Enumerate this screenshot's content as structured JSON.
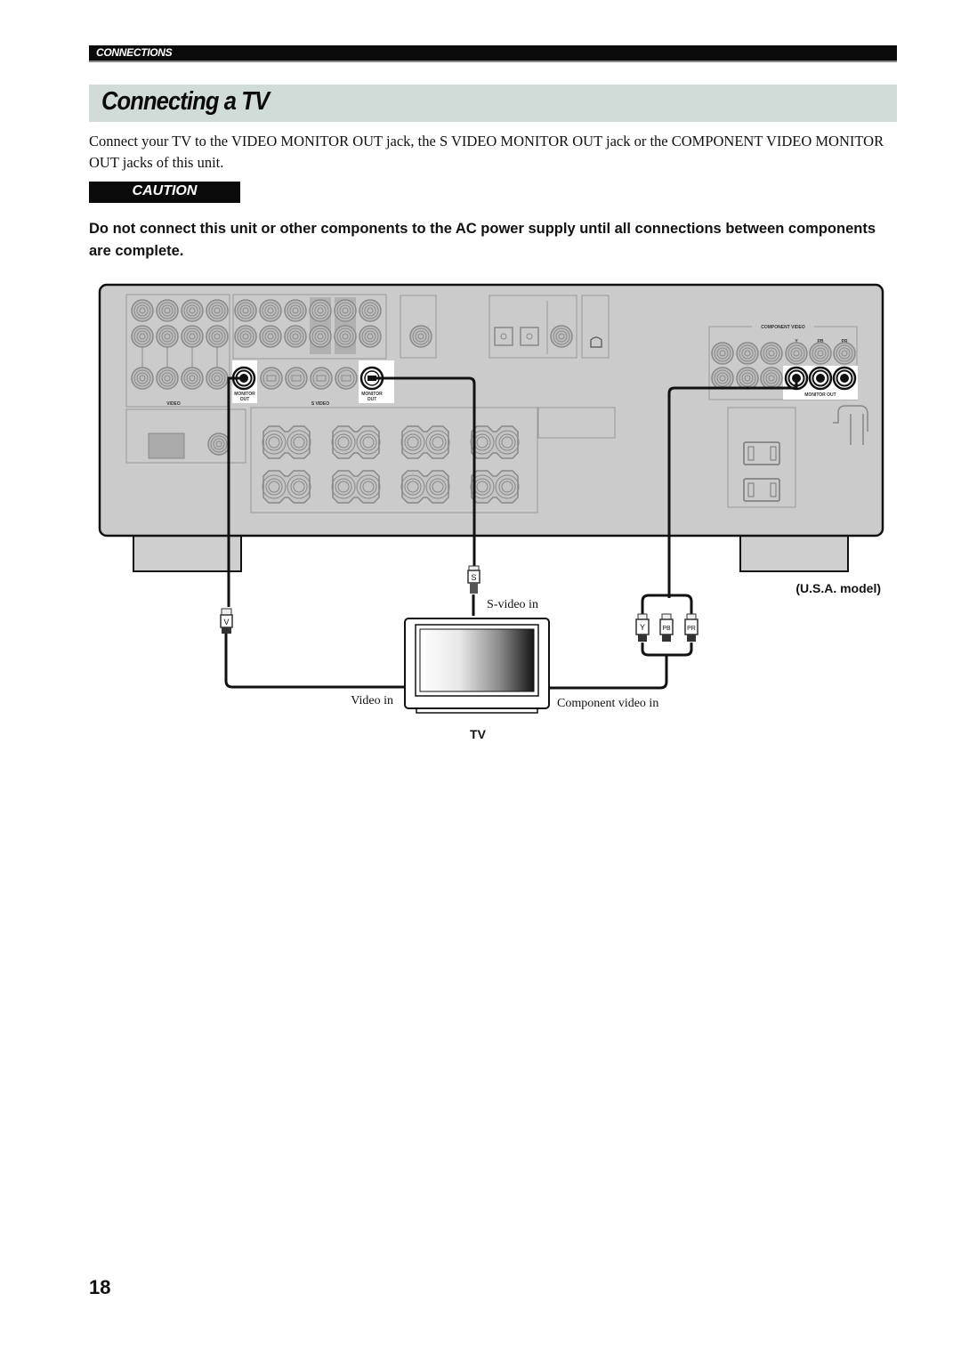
{
  "header": {
    "section_label": "CONNECTIONS",
    "page_title": "Connecting a TV"
  },
  "intro_text": "Connect your TV to the VIDEO MONITOR OUT jack, the S VIDEO MONITOR OUT jack or the COMPONENT VIDEO MONITOR OUT jacks of this unit.",
  "caution": {
    "label": "CAUTION",
    "text": "Do not connect this unit or other components to the AC power supply until all connections between components are complete."
  },
  "diagram": {
    "panel_labels": {
      "video": "VIDEO",
      "s_video": "S VIDEO",
      "monitor_out_1": "MONITOR",
      "monitor_out_2": "OUT",
      "component_video": "COMPONENT VIDEO",
      "component_monitor_out": "MONITOR OUT",
      "y": "Y",
      "pb": "PB",
      "pr": "PR"
    },
    "plugs": {
      "video": "V",
      "s_video": "S",
      "y": "Y",
      "pb": "PB",
      "pr": "PR"
    },
    "tv_labels": {
      "video_in": "Video in",
      "s_video_in": "S-video in",
      "component_video_in": "Component video in",
      "tv": "TV"
    },
    "model_note": "(U.S.A. model)"
  },
  "footer": {
    "page_number": "18"
  }
}
